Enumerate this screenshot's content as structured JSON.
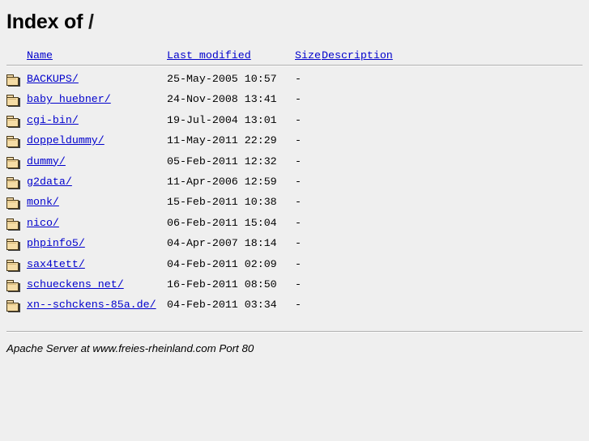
{
  "page": {
    "title_bold": "Index of",
    "title_path": "/"
  },
  "table": {
    "headers": {
      "icon": "",
      "name": "Name",
      "last_modified": "Last modified",
      "size": "Size",
      "description": "Description"
    },
    "rows": [
      {
        "icon": "folder-icon",
        "name": "BACKUPS/",
        "last_modified": "25-May-2005 10:57",
        "size": "-",
        "description": ""
      },
      {
        "icon": "folder-icon",
        "name": "baby_huebner/",
        "last_modified": "24-Nov-2008 13:41",
        "size": "-",
        "description": ""
      },
      {
        "icon": "folder-icon",
        "name": "cgi-bin/",
        "last_modified": "19-Jul-2004 13:01",
        "size": "-",
        "description": ""
      },
      {
        "icon": "folder-icon",
        "name": "doppeldummy/",
        "last_modified": "11-May-2011 22:29",
        "size": "-",
        "description": ""
      },
      {
        "icon": "folder-icon",
        "name": "dummy/",
        "last_modified": "05-Feb-2011 12:32",
        "size": "-",
        "description": ""
      },
      {
        "icon": "folder-icon",
        "name": "g2data/",
        "last_modified": "11-Apr-2006 12:59",
        "size": "-",
        "description": ""
      },
      {
        "icon": "folder-icon",
        "name": "monk/",
        "last_modified": "15-Feb-2011 10:38",
        "size": "-",
        "description": ""
      },
      {
        "icon": "folder-icon",
        "name": "nico/",
        "last_modified": "06-Feb-2011 15:04",
        "size": "-",
        "description": ""
      },
      {
        "icon": "folder-icon",
        "name": "phpinfo5/",
        "last_modified": "04-Apr-2007 18:14",
        "size": "-",
        "description": ""
      },
      {
        "icon": "folder-icon",
        "name": "sax4tett/",
        "last_modified": "04-Feb-2011 02:09",
        "size": "-",
        "description": ""
      },
      {
        "icon": "folder-icon",
        "name": "schueckens_net/",
        "last_modified": "16-Feb-2011 08:50",
        "size": "-",
        "description": ""
      },
      {
        "icon": "folder-icon",
        "name": "xn--schckens-85a.de/",
        "last_modified": "04-Feb-2011 03:34",
        "size": "-",
        "description": ""
      }
    ]
  },
  "footer": {
    "signature": "Apache Server at www.freies-rheinland.com Port 80"
  },
  "colors": {
    "background": "#efefef",
    "link": "#0000cc",
    "text": "#000000",
    "rule": "#b0b0b0",
    "folder_body": "#f5dca5",
    "folder_outline": "#4a3a18"
  }
}
